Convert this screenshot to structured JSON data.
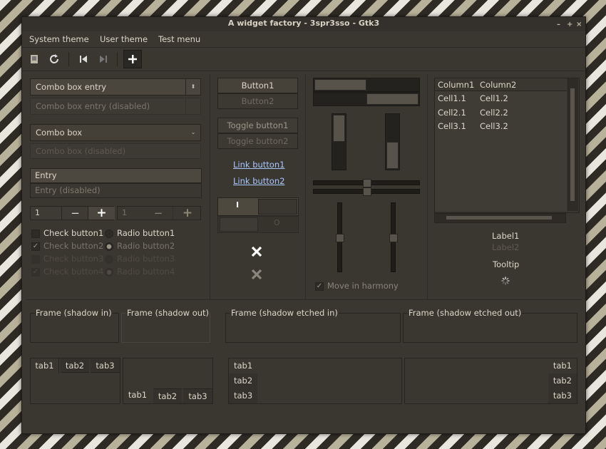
{
  "window": {
    "title": "A widget factory - 3spr3sso - Gtk3",
    "controls": [
      "–",
      "+",
      "×"
    ]
  },
  "menu": [
    "System theme",
    "User theme",
    "Test menu"
  ],
  "toolbar": {
    "icons": [
      "open-icon",
      "refresh-icon",
      "goto-first-icon",
      "goto-last-icon",
      "add-icon"
    ]
  },
  "combos": {
    "entry": "Combo box entry",
    "entry_disabled": "Combo box entry (disabled)",
    "box": "Combo box",
    "box_disabled": "Combo box (disabled)"
  },
  "entries": {
    "entry": "Entry",
    "entry_disabled": "Entry (disabled)"
  },
  "spin": {
    "value1": "1",
    "value2": "1",
    "minus": "−",
    "plus": "+"
  },
  "checks": [
    "Check button1",
    "Check button2",
    "Check button3",
    "Check button4"
  ],
  "radios": [
    "Radio button1",
    "Radio button2",
    "Radio button3",
    "Radio button4"
  ],
  "buttons": {
    "button1": "Button1",
    "button2": "Button2",
    "toggle1": "Toggle button1",
    "toggle2": "Toggle button2",
    "link1": "Link button1",
    "link2": "Link button2",
    "switch_on": "I",
    "switch_off": "O"
  },
  "progress": {
    "h1": 0.5,
    "h2": 0.5,
    "v1": 0.5,
    "v2": 0.5
  },
  "scales": {
    "h1": 0.5,
    "h2": 0.5,
    "v1": 0.5,
    "v2": 0.5
  },
  "harmony": "Move in harmony",
  "tree": {
    "columns": [
      "Column1",
      "Column2"
    ],
    "rows": [
      [
        "Cell1.1",
        "Cell1.2"
      ],
      [
        "Cell2.1",
        "Cell2.2"
      ],
      [
        "Cell3.1",
        "Cell3.2"
      ]
    ]
  },
  "labels": {
    "label1": "Label1",
    "label2": "Label2",
    "tooltip": "Tooltip"
  },
  "frames": [
    "Frame (shadow in)",
    "Frame (shadow out)",
    "Frame (shadow etched in)",
    "Frame (shadow etched out)"
  ],
  "tabs": [
    "tab1",
    "tab2",
    "tab3"
  ]
}
